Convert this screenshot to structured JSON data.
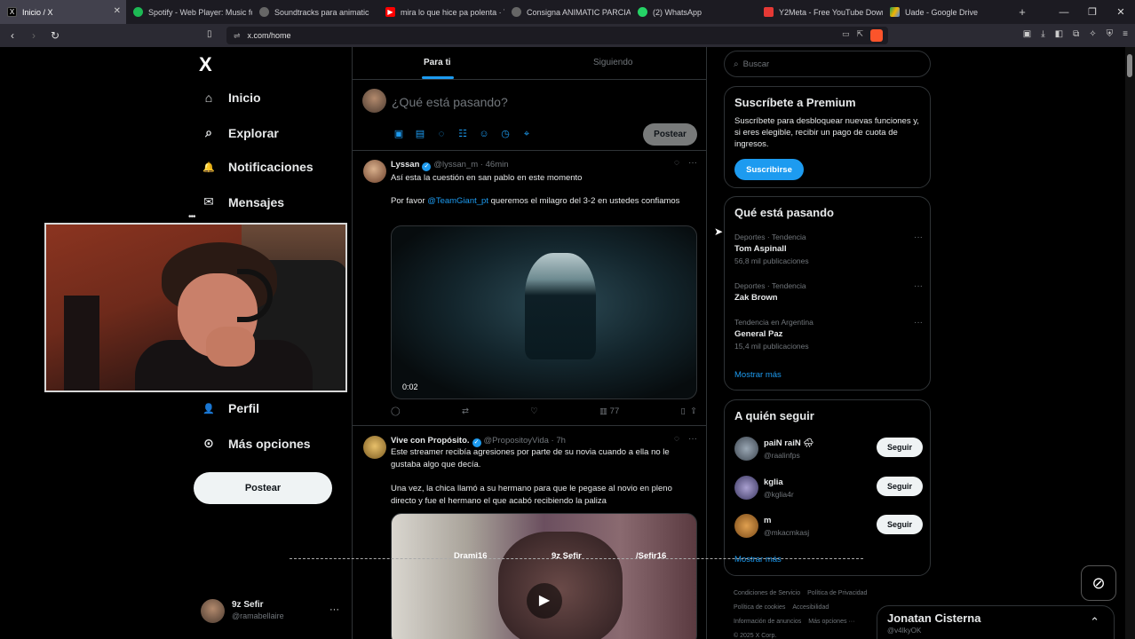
{
  "browser": {
    "tabs": [
      {
        "title": "Inicio / X",
        "icon": "x-icon",
        "color": "#000000"
      },
      {
        "title": "Spotify - Web Player: Music fo",
        "icon": "spotify-icon",
        "color": "#1db954"
      },
      {
        "title": "Soundtracks para animatic",
        "icon": "globe-icon",
        "color": "#888888"
      },
      {
        "title": "mira lo que hice pa polenta · Y",
        "icon": "youtube-icon",
        "color": "#ff0000"
      },
      {
        "title": "Consigna ANIMATIC PARCIAL",
        "icon": "globe-icon",
        "color": "#888888"
      },
      {
        "title": "(2) WhatsApp",
        "icon": "whatsapp-icon",
        "color": "#25d366"
      },
      {
        "title": "Y2Meta - Free YouTube Downl",
        "icon": "y2meta-icon",
        "color": "#e53935"
      },
      {
        "title": "Uade - Google Drive",
        "icon": "drive-icon",
        "color": "#f4b400"
      }
    ],
    "url": "x.com/home"
  },
  "sidebar": {
    "logo": "X",
    "items": [
      {
        "label": "Inicio",
        "icon": "home-icon",
        "glyph": "⌂"
      },
      {
        "label": "Explorar",
        "icon": "search-icon",
        "glyph": "⌕"
      },
      {
        "label": "Notificaciones",
        "icon": "bell-icon",
        "glyph": "🔔"
      },
      {
        "label": "Mensajes",
        "icon": "envelope-icon",
        "glyph": "✉"
      },
      {
        "label": "Perfil",
        "icon": "person-icon",
        "glyph": "👤"
      },
      {
        "label": "Más opciones",
        "icon": "more-circle-icon",
        "glyph": "⊙"
      }
    ],
    "post_label": "Postear",
    "account": {
      "name": "9z Sefir",
      "handle": "@ramabellaire",
      "menu": "···"
    }
  },
  "feed": {
    "tabs": [
      "Para ti",
      "Siguiendo"
    ],
    "composer": {
      "placeholder": "¿Qué está pasando?",
      "post_label": "Postear"
    },
    "tweets": [
      {
        "name": "Lyssan",
        "handle": "@lyssan_m",
        "time": "46min",
        "text1": "Así esta la cuestión en san pablo en este momento",
        "text2_pre": "Por favor ",
        "mention": "@TeamGiant_pt",
        "text2_post": " queremos el milagro del 3-2 en ustedes confiamos",
        "video_time": "0:02",
        "views": "77"
      },
      {
        "name": "Vive con Propósito.",
        "handle": "@PropositoyVida",
        "time": "7h",
        "text1": "Este streamer recibía agresiones por parte de su novia cuando a ella no le gustaba algo que decía.",
        "text2": "Una vez, la chica llamó a su hermano para que le pegase al novio en pleno directo y fue el hermano el que acabó recibiendo la paliza",
        "overlay": [
          "Drami16",
          "9z Sefir",
          "/Sefir16"
        ]
      }
    ]
  },
  "right": {
    "search_placeholder": "Buscar",
    "premium": {
      "title": "Suscríbete a Premium",
      "desc": "Suscríbete para desbloquear nuevas funciones y, si eres elegible, recibir un pago de cuota de ingresos.",
      "button": "Suscribirse"
    },
    "trends": {
      "title": "Qué está pasando",
      "items": [
        {
          "category": "Deportes · Tendencia",
          "topic": "Tom Aspinall",
          "count": "56,8 mil publicaciones"
        },
        {
          "category": "Deportes · Tendencia",
          "topic": "Zak Brown",
          "count": ""
        },
        {
          "category": "Tendencia en Argentina",
          "topic": "General Paz",
          "count": "15,4 mil publicaciones"
        }
      ],
      "show_more": "Mostrar más"
    },
    "who_to_follow": {
      "title": "A quién seguir",
      "items": [
        {
          "name": "paiN raiN 🌧",
          "handle": "@raalinfps",
          "button": "Seguir"
        },
        {
          "name": "kglia",
          "handle": "@kglia4r",
          "button": "Seguir"
        },
        {
          "name": "m",
          "handle": "@mkacmkasj",
          "button": "Seguir"
        }
      ],
      "show_more": "Mostrar más"
    },
    "footer": [
      "Condiciones de Servicio",
      "Política de Privacidad",
      "Política de cookies",
      "Accesibilidad",
      "Información de anuncios",
      "Más opciones ···",
      "© 2025 X Corp."
    ]
  },
  "messages_drawer": {
    "name": "Jonatan Cisterna",
    "handle": "@v4IkyOK"
  }
}
